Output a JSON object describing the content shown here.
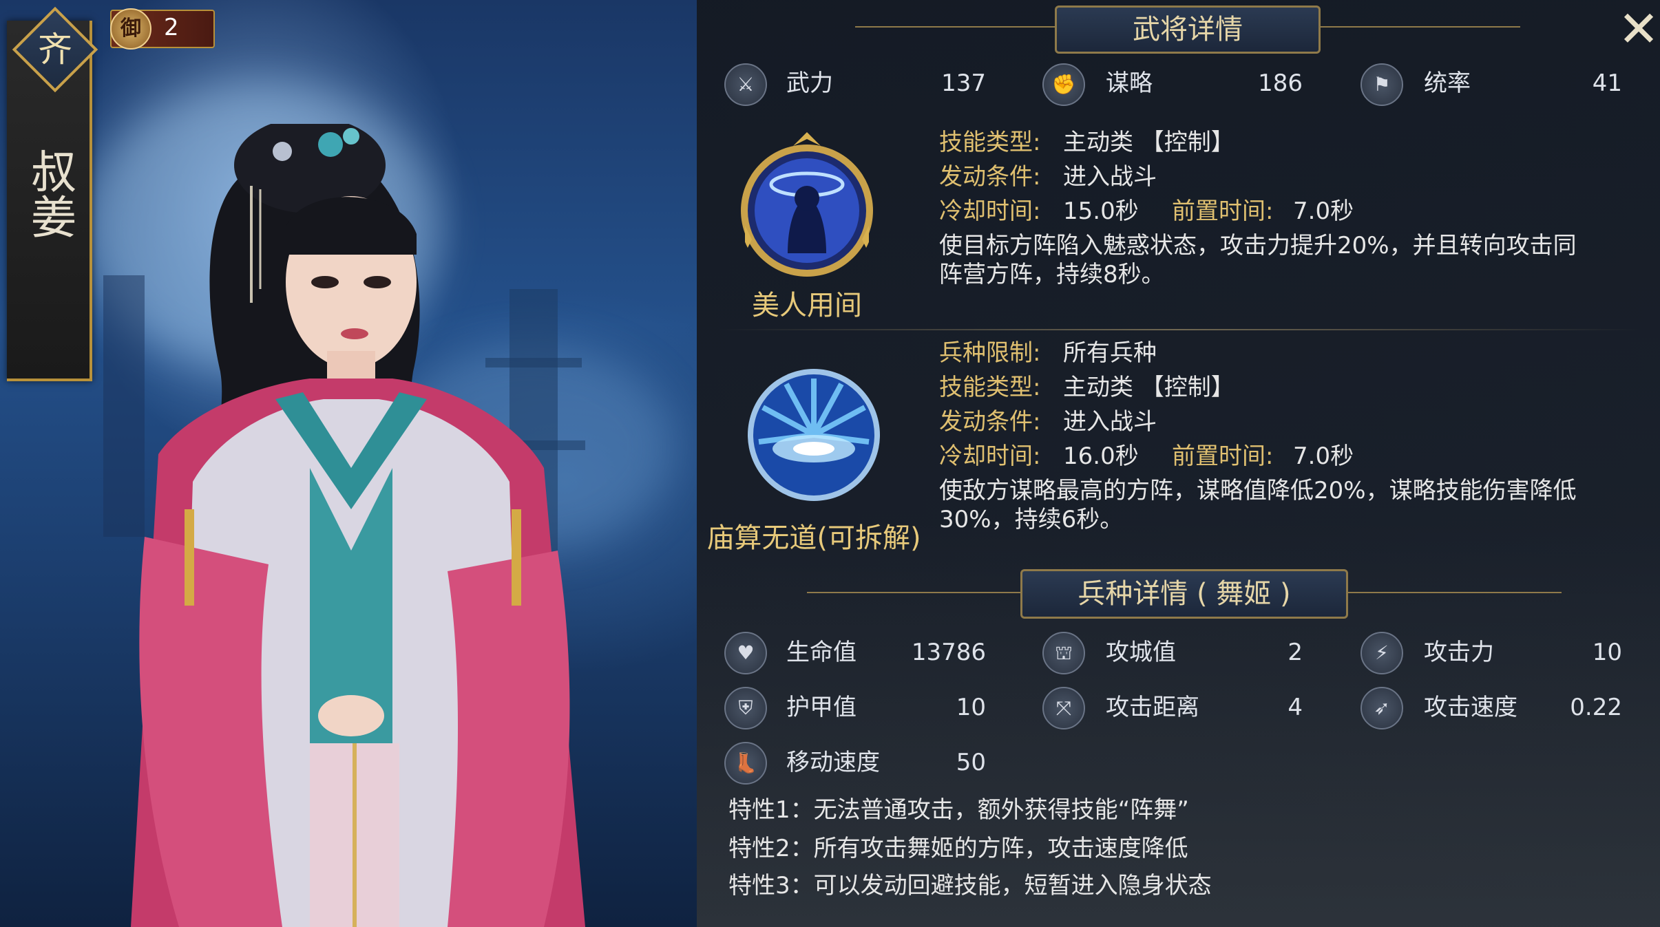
{
  "hero": {
    "name": "叔姜",
    "faction": "齐",
    "rank_label": "御",
    "rank_value": "2"
  },
  "panel": {
    "title": "武将详情",
    "close_icon": "close-icon"
  },
  "attributes": [
    {
      "icon": "crossed-swords-icon",
      "label": "武力",
      "value": "137"
    },
    {
      "icon": "flame-fist-icon",
      "label": "谋略",
      "value": "186"
    },
    {
      "icon": "banner-icon",
      "label": "统率",
      "value": "41"
    }
  ],
  "skills": [
    {
      "name": "美人用间",
      "rows": [
        {
          "label": "技能类型:",
          "value": "主动类 【控制】"
        },
        {
          "label": "发动条件:",
          "value": "进入战斗"
        }
      ],
      "cooldown_label": "冷却时间:",
      "cooldown_value": "15.0秒",
      "precast_label": "前置时间:",
      "precast_value": "7.0秒",
      "desc_line1": "使目标方阵陷入魅惑状态，攻击力提升20%，并且转向攻击同",
      "desc_line2": "阵营方阵，持续8秒。"
    },
    {
      "name": "庙算无道(可拆解)",
      "rows": [
        {
          "label": "兵种限制:",
          "value": "所有兵种"
        },
        {
          "label": "技能类型:",
          "value": "主动类 【控制】"
        },
        {
          "label": "发动条件:",
          "value": "进入战斗"
        }
      ],
      "cooldown_label": "冷却时间:",
      "cooldown_value": "16.0秒",
      "precast_label": "前置时间:",
      "precast_value": "7.0秒",
      "desc_line1": "使敌方谋略最高的方阵，谋略值降低20%，谋略技能伤害降低",
      "desc_line2": "30%，持续6秒。"
    }
  ],
  "troop": {
    "title": "兵种详情 (  舞姬 )",
    "stats": [
      {
        "icon": "heart-icon",
        "label": "生命值",
        "value": "13786"
      },
      {
        "icon": "siege-icon",
        "label": "攻城值",
        "value": "2"
      },
      {
        "icon": "attack-icon",
        "label": "攻击力",
        "value": "10"
      },
      {
        "icon": "shield-icon",
        "label": "护甲值",
        "value": "10"
      },
      {
        "icon": "range-icon",
        "label": "攻击距离",
        "value": "4"
      },
      {
        "icon": "attack-speed-icon",
        "label": "攻击速度",
        "value": "0.22"
      },
      {
        "icon": "boot-icon",
        "label": "移动速度",
        "value": "50"
      }
    ],
    "traits": [
      "特性1：无法普通攻击，额外获得技能“阵舞”",
      "特性2：所有攻击舞姬的方阵，攻击速度降低",
      "特性3：可以发动回避技能，短暂进入隐身状态"
    ]
  }
}
